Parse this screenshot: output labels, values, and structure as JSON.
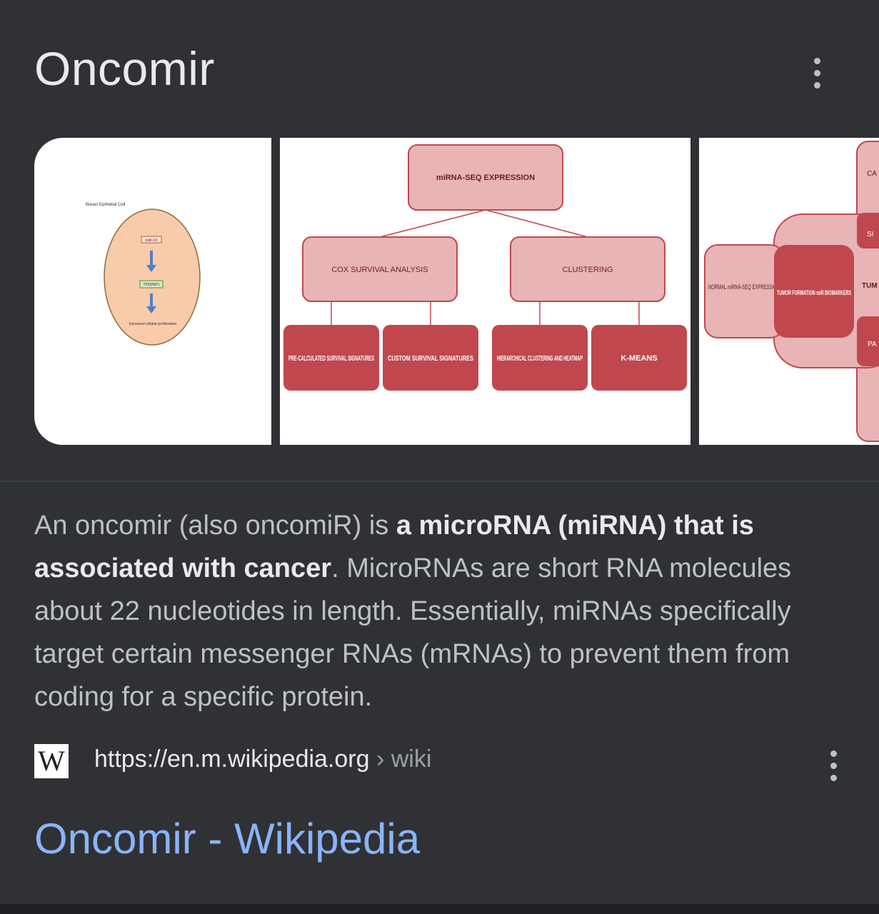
{
  "panel": {
    "title": "Oncomir",
    "menu_icon": "more-vert-icon"
  },
  "images": {
    "cell_diagram": {
      "cell_label": "Breast Epithelial Cell",
      "mirna_label": "miR-XX",
      "target_label": "TP53INP1",
      "result_label": "Increased cellular proliferation"
    },
    "flowchart": {
      "root": "miRNA-SEQ EXPRESSION",
      "branch_left": "COX SURVIVAL ANALYSIS",
      "branch_right": "CLUSTERING",
      "leaf1": "PRE-CALCULATED SURVIVAL SIGNATURES",
      "leaf2": "CUSTOM SURVIVAL SIGNATURES",
      "leaf3": "HIERARCHICAL CLUSTERING AND HEATMAP",
      "leaf4": "K-MEANS"
    },
    "cropped": {
      "normal": "NORMAL miRNA-SEQ EXPRESSION",
      "tumor": "TUMOR FORMATION miR BIOMARKERS",
      "edge_ca": "CA",
      "edge_tu": "TUM",
      "edge_pa": "PA",
      "edge_s": "SI"
    }
  },
  "description": {
    "p1": "An oncomir (also oncomiR) is ",
    "bold1": "a microRNA (miRNA) that is associated with cancer",
    "p2": ". MicroRNAs are short RNA molecules about 22 nucleotides in length. Essentially, miRNAs specifically target certain messenger RNAs (mRNAs) to prevent them from coding for a specific protein."
  },
  "source": {
    "favicon": "wikipedia-w-icon",
    "favicon_letter": "W",
    "url": "https://en.m.wikipedia.org",
    "breadcrumb": " › wiki",
    "title": "Oncomir - Wikipedia"
  },
  "colors": {
    "background": "#303134",
    "text": "#bdc1c6",
    "link": "#8ab4f8",
    "box_light": "#e8b4b6",
    "box_dark": "#c0474e"
  }
}
